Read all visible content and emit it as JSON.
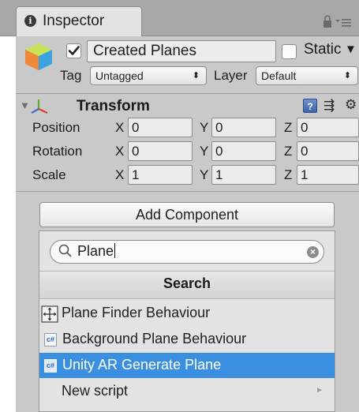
{
  "inspector": {
    "tab_title": "Inspector"
  },
  "gameobject": {
    "name": "Created Planes",
    "active_checked": true,
    "static_label": "Static",
    "static_checked": false,
    "tag_label": "Tag",
    "tag_value": "Untagged",
    "layer_label": "Layer",
    "layer_value": "Default"
  },
  "transform": {
    "title": "Transform",
    "rows": [
      {
        "label": "Position",
        "x": "0",
        "y": "0",
        "z": "0"
      },
      {
        "label": "Rotation",
        "x": "0",
        "y": "0",
        "z": "0"
      },
      {
        "label": "Scale",
        "x": "1",
        "y": "1",
        "z": "1"
      }
    ],
    "axis_x": "X",
    "axis_y": "Y",
    "axis_z": "Z"
  },
  "add_component": {
    "button_label": "Add Component",
    "search_value": "Plane",
    "header": "Search",
    "items": [
      {
        "label": "Plane Finder Behaviour",
        "icon": "move-tool-icon",
        "selected": false
      },
      {
        "label": "Background Plane Behaviour",
        "icon": "script-icon",
        "selected": false
      },
      {
        "label": "Unity AR Generate Plane",
        "icon": "script-icon",
        "selected": true
      },
      {
        "label": "New script",
        "icon": "submenu-arrow-icon",
        "selected": false
      }
    ]
  },
  "colors": {
    "selection": "#3b8fe0",
    "panel_background": "#c9c9c9",
    "tab_bar": "#a8a8a8"
  }
}
